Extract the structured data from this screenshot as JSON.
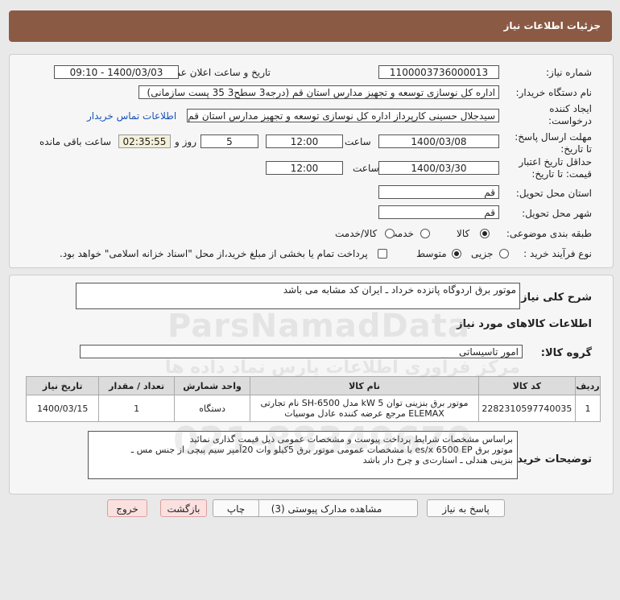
{
  "title": "جزئیات اطلاعات نیاز",
  "fields": {
    "need_no_label": "شماره نیاز:",
    "need_no": "1100003736000013",
    "announce_label": "تاریخ و ساعت اعلان عمومی:",
    "announce_value": "1400/03/03 - 09:10",
    "buyer_label": "نام دستگاه خریدار:",
    "buyer_value": "اداره کل نوسازی   توسعه و تجهیز مدارس استان قم (درجه3 سطح3  35 پست سازمانی)",
    "creator_label_1": "ایجاد کننده",
    "creator_label_2": "درخواست:",
    "creator_value": "سیدجلال حسینی کارپرداز اداره کل نوسازی   توسعه و تجهیز مدارس استان قم",
    "contact_link": "اطلاعات تماس خریدار",
    "deadline_label_1": "مهلت ارسال پاسخ:",
    "deadline_label_2": "تا تاریخ:",
    "deadline_date": "1400/03/08",
    "time_label": "ساعت",
    "deadline_time": "12:00",
    "days_value": "5",
    "days_label": "روز و",
    "remaining_time": "02:35:55",
    "remaining_label": "ساعت باقی مانده",
    "validity_label_1": "حداقل تاریخ اعتبار",
    "validity_label_2": "قیمت: تا تاریخ:",
    "validity_date": "1400/03/30",
    "validity_time": "12:00",
    "province_label": "استان محل تحویل:",
    "province_value": "قم",
    "city_label": "شهر محل تحویل:",
    "city_value": "قم",
    "category_label": "طبقه بندی موضوعی:",
    "category_options": [
      "کالا",
      "خدمت",
      "کالا/خدمت"
    ],
    "process_label": "نوع فرآیند خرید :",
    "process_options": [
      "جزیی",
      "متوسط"
    ],
    "payment_text": "پرداخت تمام یا بخشی از مبلغ خرید،از محل \"اسناد خزانه اسلامی\" خواهد بود."
  },
  "description": {
    "label": "شرح کلی نیاز:",
    "value": "موتور برق اردوگاه   پانزده خرداد ـ ایران کد مشابه می باشد"
  },
  "goods": {
    "section_title": "اطلاعات کالاهای مورد نیاز",
    "group_label": "گروه کالا:",
    "group_value": "امور تاسیساتی",
    "columns": [
      "ردیف",
      "کد کالا",
      "نام کالا",
      "واحد شمارش",
      "تعداد / مقدار",
      "تاریخ نیاز"
    ],
    "rows": [
      {
        "row": "1",
        "code": "2282310597740035",
        "name_1": "موتور برق بنزینی توان kW 5 مدل SH-6500 نام تجارتی",
        "name_2": "ELEMAX مرجع عرضه کننده عادل موسیات",
        "unit": "دستگاه",
        "qty": "1",
        "date": "1400/03/15"
      }
    ]
  },
  "buyer_notes": {
    "label": "توضیحات خریدار:",
    "line1": "براساس مشخصات شرایط پرداخت پیوست و مشخصات عمومی ذیل قیمت گذاری نمائید",
    "line2": "موتور برق  es/x 6500  EP با مشخصات عمومی موتور برق 5کیلو وات 20آمپر سیم پیچی از جنس مس ـ",
    "line3": "بنزینی هندلی  ـ استارت‌ی و  چرخ دار باشد"
  },
  "buttons": {
    "reply": "پاسخ به نیاز",
    "view_docs": "مشاهده مدارک پیوستی (3)",
    "print": "چاپ",
    "back": "بازگشت",
    "exit": "خروج"
  },
  "watermark": {
    "brand": "ParsNamadData",
    "sub": "مرکز فرآوری اطلاعات پارس نماد داده ها",
    "phone": "021-88349670"
  },
  "colors": {
    "title_bar": "#8b5a44",
    "link": "#1a52b8"
  }
}
